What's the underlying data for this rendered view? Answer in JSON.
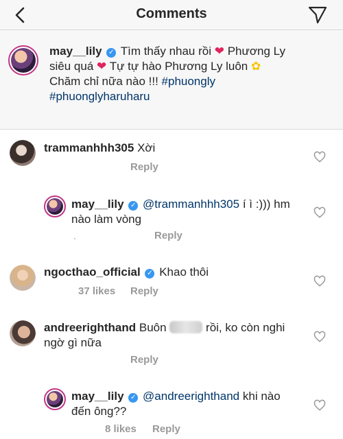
{
  "header": {
    "title": "Comments"
  },
  "caption": {
    "username": "may__lily",
    "line1_text": "Tìm thấy nhau rồi",
    "line1_after": "Phương Ly",
    "line2_text": "siêu quá",
    "line2_after": "Tự tự hào Phương Ly luôn",
    "line3_text": "Chăm chỉ nữa nào !!!",
    "hashtag1": "#phuongly",
    "hashtag2": "#phuonglyharuharu"
  },
  "comments": [
    {
      "username": "trammanhhh305",
      "text": "Xời",
      "reply_label": "Reply"
    },
    {
      "username": "may__lily",
      "mention": "@trammanhhh305",
      "text_line1": "í ì :))) hm",
      "text_line2": "nào làm vòng",
      "reply_label": "Reply"
    },
    {
      "username": "ngocthao_official",
      "text": "Khao thôi",
      "likes": "37 likes",
      "reply_label": "Reply"
    },
    {
      "username": "andreerighthand",
      "text_before": "Buôn",
      "text_after": "rồi,  ko còn nghi",
      "text_line2": "ngờ gì nữa",
      "reply_label": "Reply"
    },
    {
      "username": "may__lily",
      "mention": "@andreerighthand",
      "text_line1": "khi nào",
      "text_line2": "đến ông??",
      "likes": "8 likes",
      "reply_label": "Reply"
    }
  ],
  "colors": {
    "link": "#003569",
    "verified": "#3897f0",
    "meta": "#999999",
    "story_ring": "#c13584"
  },
  "icons": [
    "back-icon",
    "send-icon",
    "verified-icon",
    "heart-outline-icon"
  ]
}
